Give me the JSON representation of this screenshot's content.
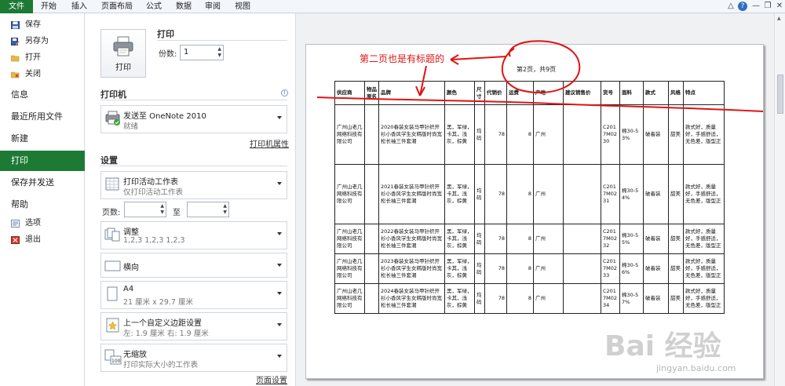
{
  "ribbon": {
    "tabs": [
      "文件",
      "开始",
      "插入",
      "页面布局",
      "公式",
      "数据",
      "审阅",
      "视图"
    ]
  },
  "nav": {
    "small_top": [
      {
        "label": "保存",
        "icon": "save-icon"
      },
      {
        "label": "另存为",
        "icon": "save-as-icon"
      },
      {
        "label": "打开",
        "icon": "open-folder-icon"
      },
      {
        "label": "关闭",
        "icon": "close-folder-icon"
      }
    ],
    "big": [
      "信息",
      "最近所用文件",
      "新建",
      "打印",
      "保存并发送",
      "帮助"
    ],
    "active": "打印",
    "small_bottom": [
      {
        "label": "选项",
        "icon": "options-icon"
      },
      {
        "label": "退出",
        "icon": "exit-icon"
      }
    ]
  },
  "print": {
    "section_title": "打印",
    "button_label": "打印",
    "copies_label": "份数:",
    "copies_value": "1"
  },
  "printer": {
    "section_title": "打印机",
    "name": "发送至 OneNote 2010",
    "status": "就绪",
    "properties_link": "打印机属性"
  },
  "settings": {
    "section_title": "设置",
    "what": {
      "title": "打印活动工作表",
      "sub": "仅打印活动工作表"
    },
    "pages_label": "页数:",
    "to_label": "至",
    "collate": {
      "title": "调整",
      "sub": "1,2,3    1,2,3    1,2,3"
    },
    "orientation": {
      "title": "横向"
    },
    "paper": {
      "title": "A4",
      "sub": "21 厘米 x 29.7 厘米"
    },
    "margins": {
      "title": "上一个自定义边距设置",
      "sub": "左: 1.9 厘米    右: 1.9 厘米"
    },
    "scaling": {
      "title": "无缩放",
      "sub": "打印实际大小的工作表"
    },
    "page_setup_link": "页面设置"
  },
  "preview": {
    "page_number": "第2页，共9页",
    "annotation": "第二页也是有标题的",
    "columns": [
      "供应商",
      "物品原名",
      "品牌",
      "颜色",
      "尺寸",
      "代销价",
      "运费",
      "产地",
      "建议销售价",
      "货号",
      "面料",
      "款式",
      "风格",
      "特点"
    ],
    "rows": [
      [
        "广州山老几网络科技有限公司",
        "",
        "2020春装女装马甲针织开衫小香风学生女韩版时尚宽松长袖三件套潮",
        "黑，军绿，卡其，浅灰，棕黄",
        "均码",
        "78",
        "8",
        "广州",
        "",
        "C2017M0230",
        "棉30-53%",
        "破着装",
        "甜美",
        "款式好，质量好，手感舒适，无色差，版型正"
      ],
      [
        "广州山老几网络科技有限公司",
        "",
        "2021春装女装马甲针织开衫小香风学生女韩版时尚宽松长袖三件套潮",
        "黑，军绿，卡其，浅灰，棕黄",
        "均码",
        "78",
        "8",
        "广州",
        "",
        "C2017M0231",
        "棉30-54%",
        "破着装",
        "甜美",
        "款式好，质量好，手感舒适，无色差，版型正"
      ],
      [
        "广州山老几网络科技有限公司",
        "",
        "2022春装女装马甲针织开衫小香风学生女韩版时尚宽松长袖三件套潮",
        "黑，军绿，卡其，浅灰，棕黄",
        "均码",
        "78",
        "8",
        "广州",
        "",
        "C2017M0232",
        "棉30-55%",
        "破着装",
        "甜美",
        "款式好，质量好，手感舒适，无色差，版型正"
      ],
      [
        "广州山老几网络科技有限公司",
        "",
        "2023春装女装马甲针织开衫小香风学生女韩版时尚宽松长袖三件套潮",
        "黑，军绿，卡其，浅灰，棕黄",
        "均码",
        "78",
        "8",
        "广州",
        "",
        "C2017M0233",
        "棉30-56%",
        "破着装",
        "甜美",
        "款式好，质量好，手感舒适，无色差，版型正"
      ],
      [
        "广州山老几网络科技有限公司",
        "",
        "2024春装女装马甲针织开衫小香风学生女韩版时尚宽松长袖三件套潮",
        "黑，军绿，卡其，浅灰，棕黄",
        "均码",
        "78",
        "8",
        "广州",
        "",
        "C2017M0234",
        "棉30-57%",
        "破着装",
        "甜美",
        "款式好，质量好，手感舒适，无色差，版型正"
      ]
    ]
  },
  "watermark": {
    "brand": "Bai 经验",
    "url": "jingyan.baidu.com"
  },
  "colors": {
    "accent": "#1d7a35",
    "annotation": "#e01414"
  }
}
